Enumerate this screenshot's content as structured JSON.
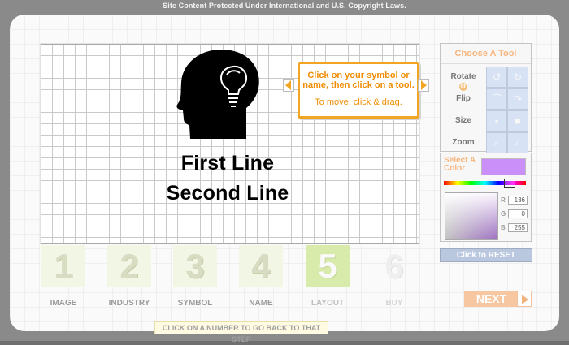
{
  "header": {
    "copyright_notice": "Site Content Protected Under International and U.S. Copyright Laws."
  },
  "canvas": {
    "symbol_icon": "head-with-lightbulb",
    "name_line_1": "First Line",
    "name_line_2": "Second Line",
    "instruction_1": "Click on your symbol or name, then click on a tool.",
    "instruction_2": "To move, click & drag."
  },
  "tools": {
    "title": "Choose A Tool",
    "rotate_label": "Rotate",
    "or_label": "or",
    "flip_label": "Flip",
    "size_label": "Size",
    "zoom_label": "Zoom"
  },
  "color": {
    "select_label": "Select A Color",
    "swatch": "#ca8ff8",
    "r_label": "R",
    "g_label": "G",
    "b_label": "B",
    "r_value": "136",
    "g_value": "0",
    "b_value": "255",
    "reset_label": "Click to RESET"
  },
  "steps": [
    {
      "number": "1",
      "label": "IMAGE"
    },
    {
      "number": "2",
      "label": "INDUSTRY"
    },
    {
      "number": "3",
      "label": "SYMBOL"
    },
    {
      "number": "4",
      "label": "NAME"
    },
    {
      "number": "5",
      "label": "LAYOUT"
    },
    {
      "number": "6",
      "label": "BUY"
    }
  ],
  "navigation": {
    "next_label": "NEXT",
    "footer_label": "CLICK ON A NUMBER TO GO BACK TO THAT STEP"
  },
  "colors": {
    "accent_orange": "#f2a522",
    "active_step": "#d9ebab",
    "tool_button": "#d7e2f5"
  }
}
